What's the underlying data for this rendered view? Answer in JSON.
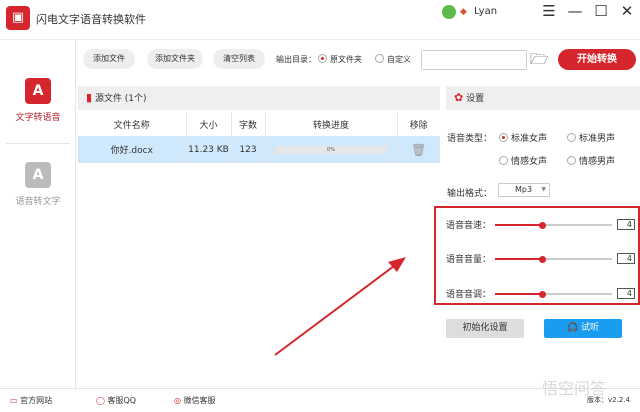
{
  "app": {
    "title": "闪电文字语音转换软件",
    "user": "Lyan"
  },
  "window": {
    "menu_icon": "menu-icon",
    "minimize_icon": "minimize-icon",
    "maximize_icon": "maximize-icon",
    "close_icon": "close-icon"
  },
  "sidebar": {
    "items": [
      {
        "label": "文字转语音",
        "active": true
      },
      {
        "label": "语音转文字",
        "active": false
      }
    ]
  },
  "toolbar": {
    "add_file": "添加文件",
    "add_folder": "添加文件夹",
    "clear_list": "清空列表",
    "output_dir_label": "输出目录：",
    "option_source": "原文件夹",
    "option_custom": "自定义",
    "path_value": "",
    "start": "开始转换"
  },
  "files": {
    "title": "源文件 (1个)",
    "columns": [
      "文件名称",
      "大小",
      "字数",
      "转换进度",
      "移除"
    ],
    "rows": [
      {
        "name": "你好.docx",
        "size": "11.23 KB",
        "words": "123",
        "progress": "0%"
      }
    ]
  },
  "settings": {
    "title": "设置",
    "voice_type_label": "语音类型：",
    "voice_types": [
      "标准女声",
      "标准男声",
      "情感女声",
      "情感男声"
    ],
    "selected_voice": "标准女声",
    "format_label": "输出格式：",
    "format_value": "Mp3",
    "sliders": [
      {
        "label": "语音音速：",
        "value": "4",
        "fraction": 0.4
      },
      {
        "label": "语音音量：",
        "value": "4",
        "fraction": 0.4
      },
      {
        "label": "语音音调：",
        "value": "4",
        "fraction": 0.4
      }
    ],
    "reset": "初始化设置",
    "preview": "试听"
  },
  "footer": {
    "website": "官方网站",
    "qq": "客服QQ",
    "wechat": "微信客服",
    "version": "版本：v2.2.4"
  },
  "watermark": "悟空问答",
  "colors": {
    "accent": "#d6262d",
    "blue": "#1a9cf0"
  }
}
